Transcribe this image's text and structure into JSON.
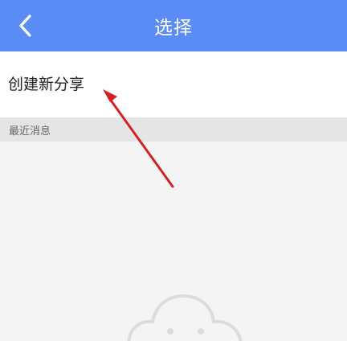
{
  "header": {
    "title": "选择",
    "back_icon": "chevron-left-icon",
    "background_color": "#5b8cf5"
  },
  "create_share": {
    "label": "创建新分享"
  },
  "recent": {
    "section_label": "最近消息"
  },
  "empty_state": {
    "icon": "cloud-face-icon"
  },
  "annotation": {
    "type": "arrow",
    "color": "#d32222"
  }
}
